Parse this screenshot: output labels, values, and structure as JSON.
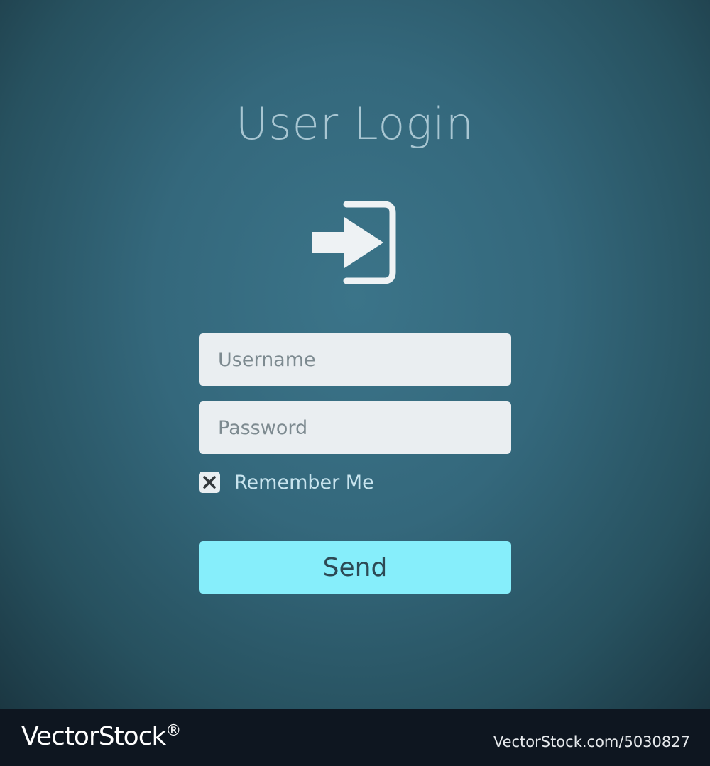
{
  "login_form": {
    "title": "User Login",
    "icon": "sign-in-icon",
    "username": {
      "placeholder": "Username",
      "value": ""
    },
    "password": {
      "placeholder": "Password",
      "value": ""
    },
    "remember_me": {
      "label": "Remember Me",
      "checked": true,
      "check_icon": "x-mark-icon"
    },
    "submit": {
      "label": "Send"
    }
  },
  "footer": {
    "brand": "VectorStock",
    "brand_mark": "®",
    "image_id": "VectorStock.com/5030827"
  },
  "colors": {
    "background_center": "#3b7489",
    "background_edge": "#1b3742",
    "title": "#a8c6d2",
    "field_background": "#eaeef1",
    "button_background": "#86eefb",
    "button_text": "#2d4a55",
    "footer_background": "#0e1620"
  }
}
